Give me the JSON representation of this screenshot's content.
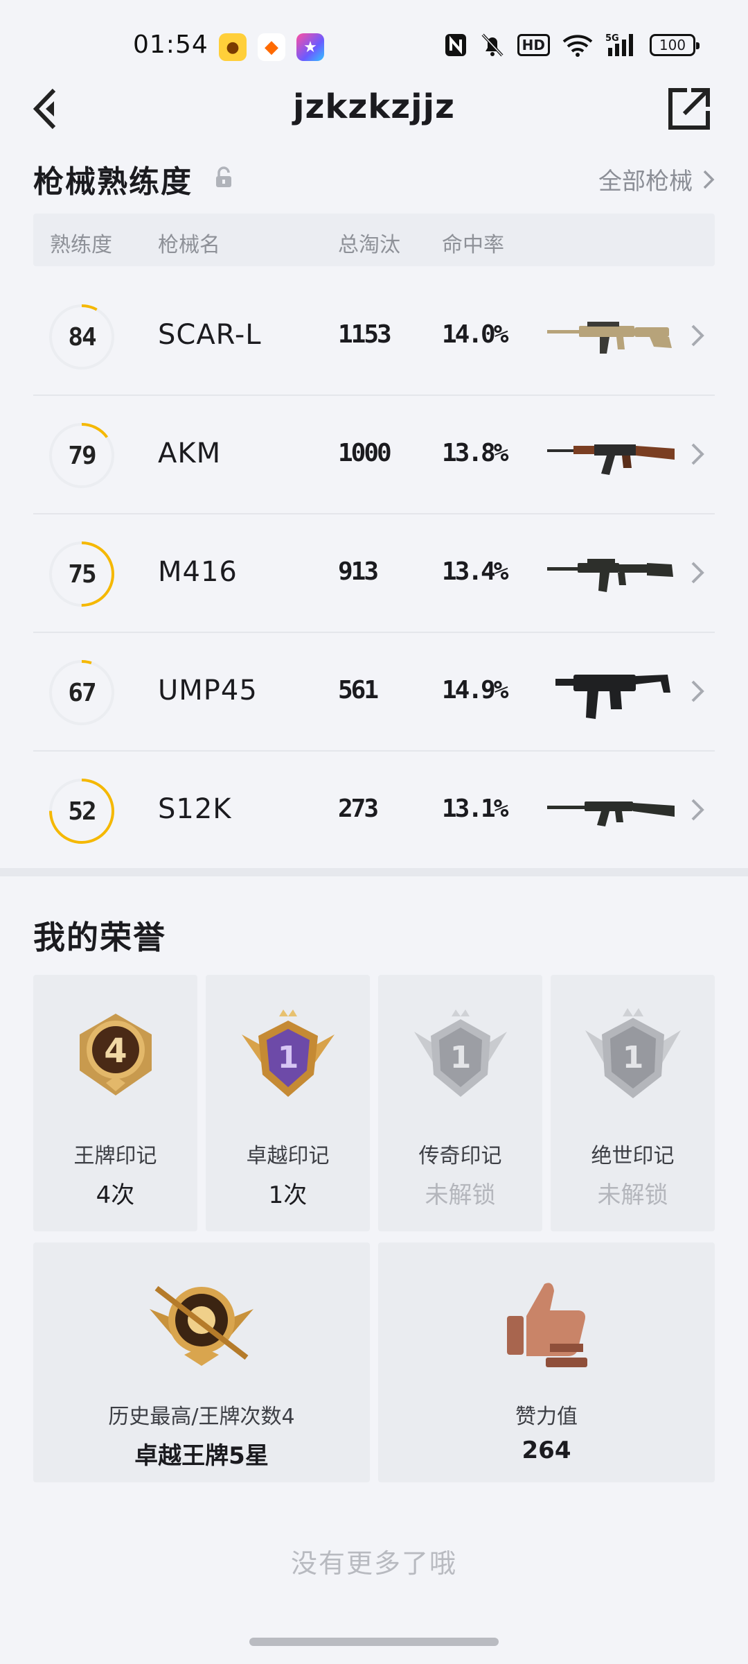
{
  "status_bar": {
    "time": "01:54",
    "hd_label": "HD",
    "network_label": "5G",
    "battery": "100",
    "icons": [
      "nfc-icon",
      "mute-bell-icon",
      "hd-icon",
      "wifi-icon",
      "signal-icon",
      "battery-icon"
    ]
  },
  "header": {
    "title": "jzkzkzjjz"
  },
  "proficiency": {
    "title": "枪械熟练度",
    "all_guns_link": "全部枪械",
    "columns": {
      "proficiency": "熟练度",
      "name": "枪械名",
      "kills": "总淘汰",
      "accuracy": "命中率"
    },
    "guns": [
      {
        "level": "84",
        "ring_progress": 0.08,
        "name": "SCAR-L",
        "kills": "1153",
        "accuracy": "14.0%",
        "image": "scar-l-rifle",
        "tint": "#b7a37a"
      },
      {
        "level": "79",
        "ring_progress": 0.15,
        "name": "AKM",
        "kills": "1000",
        "accuracy": "13.8%",
        "image": "akm-rifle",
        "tint": "#7a3e22"
      },
      {
        "level": "75",
        "ring_progress": 0.5,
        "name": "M416",
        "kills": "913",
        "accuracy": "13.4%",
        "image": "m416-rifle",
        "tint": "#2d2f2b"
      },
      {
        "level": "67",
        "ring_progress": 0.05,
        "name": "UMP45",
        "kills": "561",
        "accuracy": "14.9%",
        "image": "ump45-smg",
        "tint": "#1f2022"
      },
      {
        "level": "52",
        "ring_progress": 0.75,
        "name": "S12K",
        "kills": "273",
        "accuracy": "13.1%",
        "image": "s12k-shotgun",
        "tint": "#2b2e2a"
      }
    ]
  },
  "honors": {
    "title": "我的荣誉",
    "badges": [
      {
        "name": "王牌印记",
        "value": "4次",
        "number": "4",
        "locked": false
      },
      {
        "name": "卓越印记",
        "value": "1次",
        "number": "1",
        "locked": false
      },
      {
        "name": "传奇印记",
        "value": "未解锁",
        "number": "1",
        "locked": true
      },
      {
        "name": "绝世印记",
        "value": "未解锁",
        "number": "1",
        "locked": true
      }
    ],
    "highest_rank": {
      "label": "历史最高/王牌次数4",
      "value": "卓越王牌5星"
    },
    "likes": {
      "label": "赞力值",
      "value": "264"
    }
  },
  "footer": {
    "no_more": "没有更多了哦"
  },
  "colors": {
    "accent_ring": "#f5b800",
    "ring_track": "#ebedf1",
    "muted_text": "#8e9198",
    "background": "#f3f4f8"
  }
}
